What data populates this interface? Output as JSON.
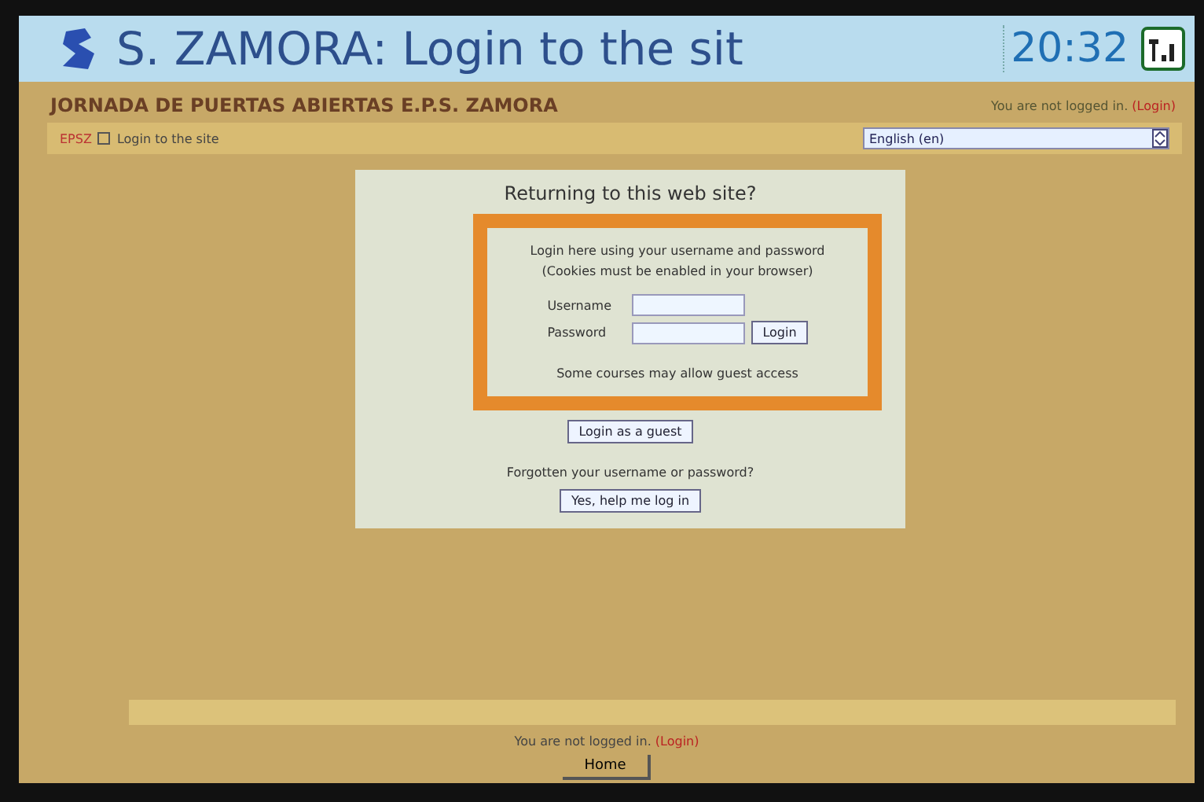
{
  "status_bar": {
    "title": "S. ZAMORA: Login to the sit",
    "time": "20:32"
  },
  "header": {
    "site_name": "JORNADA DE PUERTAS ABIERTAS E.P.S. ZAMORA",
    "login_info": "You are not logged in.",
    "login_link": "(Login)"
  },
  "navbar": {
    "breadcrumb_home": "EPSZ",
    "breadcrumb_current": "Login to the site",
    "language": "English (en)"
  },
  "login_panel": {
    "heading": "Returning to this web site?",
    "intro": "Login here using your username and password",
    "cookies_note": "(Cookies must be enabled in your browser)",
    "username_label": "Username",
    "password_label": "Password",
    "login_button": "Login",
    "guest_note": "Some courses may allow guest access",
    "guest_button": "Login as a guest",
    "forgot_question": "Forgotten your username or password?",
    "forgot_button": "Yes, help me log in"
  },
  "footer": {
    "login_info": "You are not logged in.",
    "login_link": "(Login)",
    "home_button": "Home"
  }
}
